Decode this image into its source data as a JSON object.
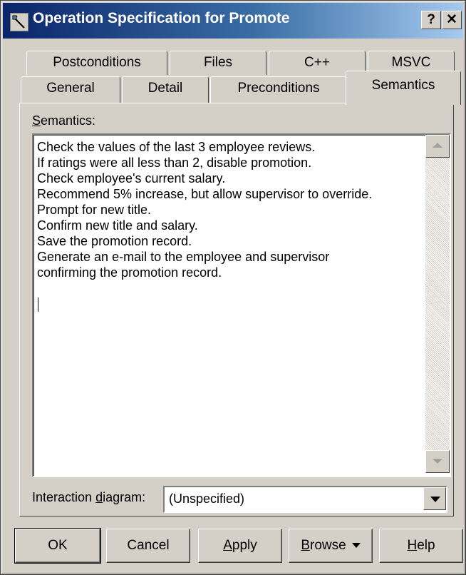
{
  "window": {
    "title": "Operation Specification for Promote",
    "help_button": "?",
    "close_button": "✕"
  },
  "tabs": {
    "row_back": [
      "Postconditions",
      "Files",
      "C++",
      "MSVC"
    ],
    "row_front": [
      "General",
      "Detail",
      "Preconditions",
      "Semantics"
    ],
    "selected": "Semantics"
  },
  "semantics": {
    "label_prefix": "",
    "label_accel": "S",
    "label_rest": "emantics:",
    "lines": [
      "Check the values of the last 3 employee reviews.",
      "If ratings were all less than 2, disable promotion.",
      "Check employee's current salary.",
      "Recommend 5% increase, but allow supervisor to override.",
      "Prompt for new title.",
      "Confirm new title and salary.",
      "Save the promotion record.",
      "Generate an e-mail to the employee and supervisor",
      "confirming the promotion record."
    ]
  },
  "interaction_diagram": {
    "label_prefix": "Interaction ",
    "label_accel": "d",
    "label_rest": "iagram:",
    "value": "(Unspecified)"
  },
  "buttons": {
    "ok": "OK",
    "cancel": "Cancel",
    "apply_accel": "A",
    "apply_rest": "pply",
    "browse_accel": "B",
    "browse_rest": "rowse",
    "help_accel": "H",
    "help_rest": "elp"
  }
}
